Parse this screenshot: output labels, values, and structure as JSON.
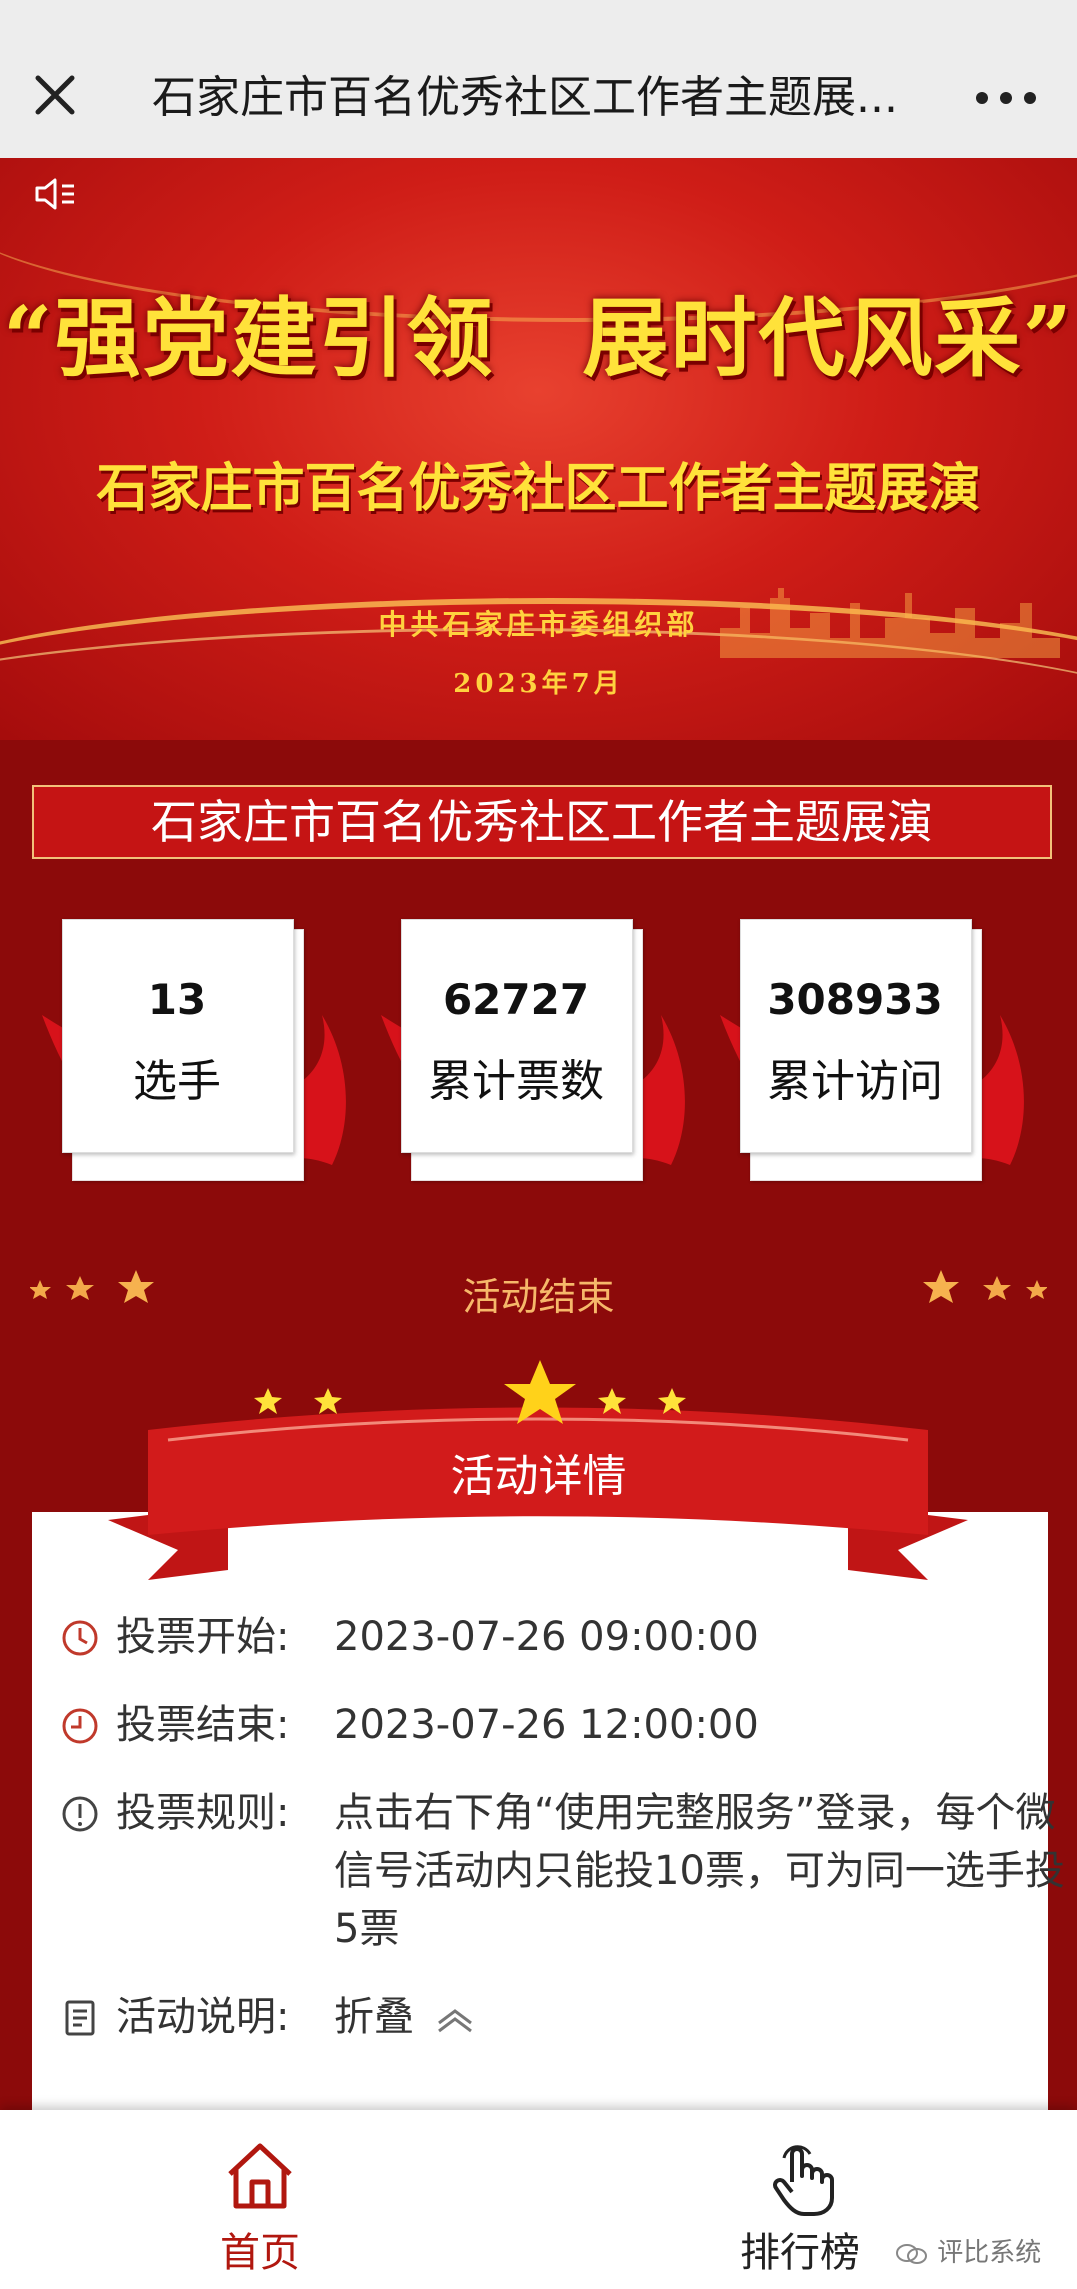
{
  "nav": {
    "title": "石家庄市百名优秀社区工作者主题展..."
  },
  "banner": {
    "slogan": "“强党建引领　展时代风采”",
    "subtitle": "石家庄市百名优秀社区工作者主题展演",
    "org": "中共石家庄市委组织部",
    "date": "2023年7月"
  },
  "title": "石家庄市百名优秀社区工作者主题展演",
  "stats": [
    {
      "value": "13",
      "label": "选手"
    },
    {
      "value": "62727",
      "label": "累计票数"
    },
    {
      "value": "308933",
      "label": "累计访问"
    }
  ],
  "status": "活动结束",
  "details": {
    "heading": "活动详情",
    "vote_start_label": "投票开始:",
    "vote_start_value": "2023-07-26 09:00:00",
    "vote_end_label": "投票结束:",
    "vote_end_value": "2023-07-26 12:00:00",
    "rules_label": "投票规则:",
    "rules_value": "点击右下角“使用完整服务”登录，每个微信号活动内只能投10票，可为同一选手投5票",
    "desc_label": "活动说明:",
    "desc_value": "折叠"
  },
  "tabs": {
    "home": "首页",
    "ranking": "排行榜"
  },
  "watermark": "评比系统",
  "colors": {
    "primary": "#c51414",
    "background": "#8c0a0a",
    "accent": "#ffe23a",
    "status": "#f6b86a"
  }
}
